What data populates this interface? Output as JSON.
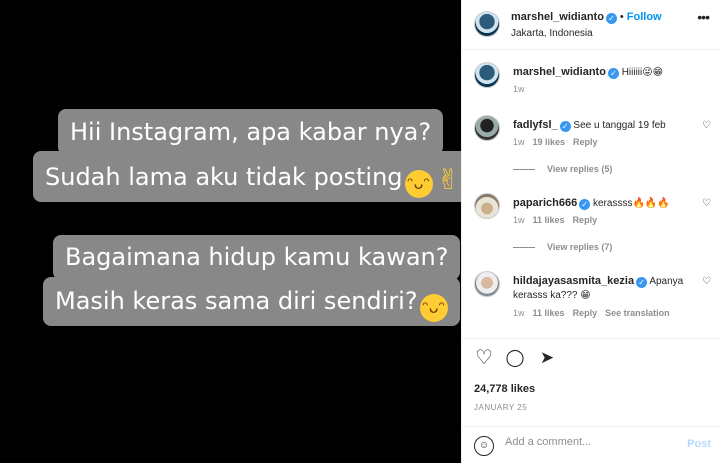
{
  "media": {
    "lines": [
      "Hii Instagram, apa kabar nya?",
      "Sudah lama aku tidak posting",
      "Bagaimana hidup kamu kawan?",
      "Masih keras sama diri sendiri?"
    ],
    "emoji_grin": "😁",
    "emoji_peace": "✌",
    "bubble_color": "#888888"
  },
  "header": {
    "username": "marshel_widianto",
    "dot": "•",
    "follow_label": "Follow",
    "location": "Jakarta, Indonesia",
    "more_icon": "•••"
  },
  "caption": {
    "username": "marshel_widianto",
    "text": "Hiiiiii😜😁",
    "time": "1w"
  },
  "comments": [
    {
      "username": "fadlyfsl_",
      "text": "See u tanggal 19 feb",
      "time": "1w",
      "likes": "19 likes",
      "reply": "Reply",
      "view_replies": "View replies (5)"
    },
    {
      "username": "paparich666",
      "text": "kerassss🔥🔥🔥",
      "time": "1w",
      "likes": "11 likes",
      "reply": "Reply",
      "view_replies": "View replies (7)"
    },
    {
      "username": "hildajayasasmita_kezia",
      "text": "Apanya",
      "text2": "kerasss ka??? 😁",
      "time": "1w",
      "likes": "11 likes",
      "reply": "Reply",
      "see_translation": "See translation"
    }
  ],
  "actions": {
    "like_icon": "♡",
    "comment_icon": "◯",
    "share_icon": "➤",
    "likes": "24,778 likes",
    "date": "JANUARY 25"
  },
  "add_comment": {
    "placeholder": "Add a comment...",
    "post_label": "Post",
    "emoji_icon": "☺"
  },
  "colors": {
    "accent": "#0095f6",
    "verified": "#3897f0",
    "muted": "#8e8e8e",
    "post_disabled": "#b3dbff"
  }
}
